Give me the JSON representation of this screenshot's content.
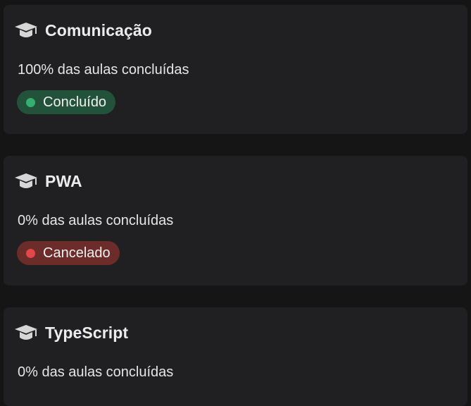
{
  "courses": [
    {
      "icon": "graduation-cap-icon",
      "title": "Comunicação",
      "progress_text": "100% das aulas concluídas",
      "status": {
        "label": "Concluído",
        "color": "#35b06f",
        "bg": "#22533a"
      }
    },
    {
      "icon": "graduation-cap-icon",
      "title": "PWA",
      "progress_text": "0% das aulas concluídas",
      "status": {
        "label": "Cancelado",
        "color": "#e2474a",
        "bg": "#6b2c2a"
      }
    },
    {
      "icon": "graduation-cap-icon",
      "title": "TypeScript",
      "progress_text": "0% das aulas concluídas"
    }
  ],
  "colors": {
    "page_bg": "#151515",
    "card_bg": "#202022",
    "text": "#e6e6e6"
  }
}
